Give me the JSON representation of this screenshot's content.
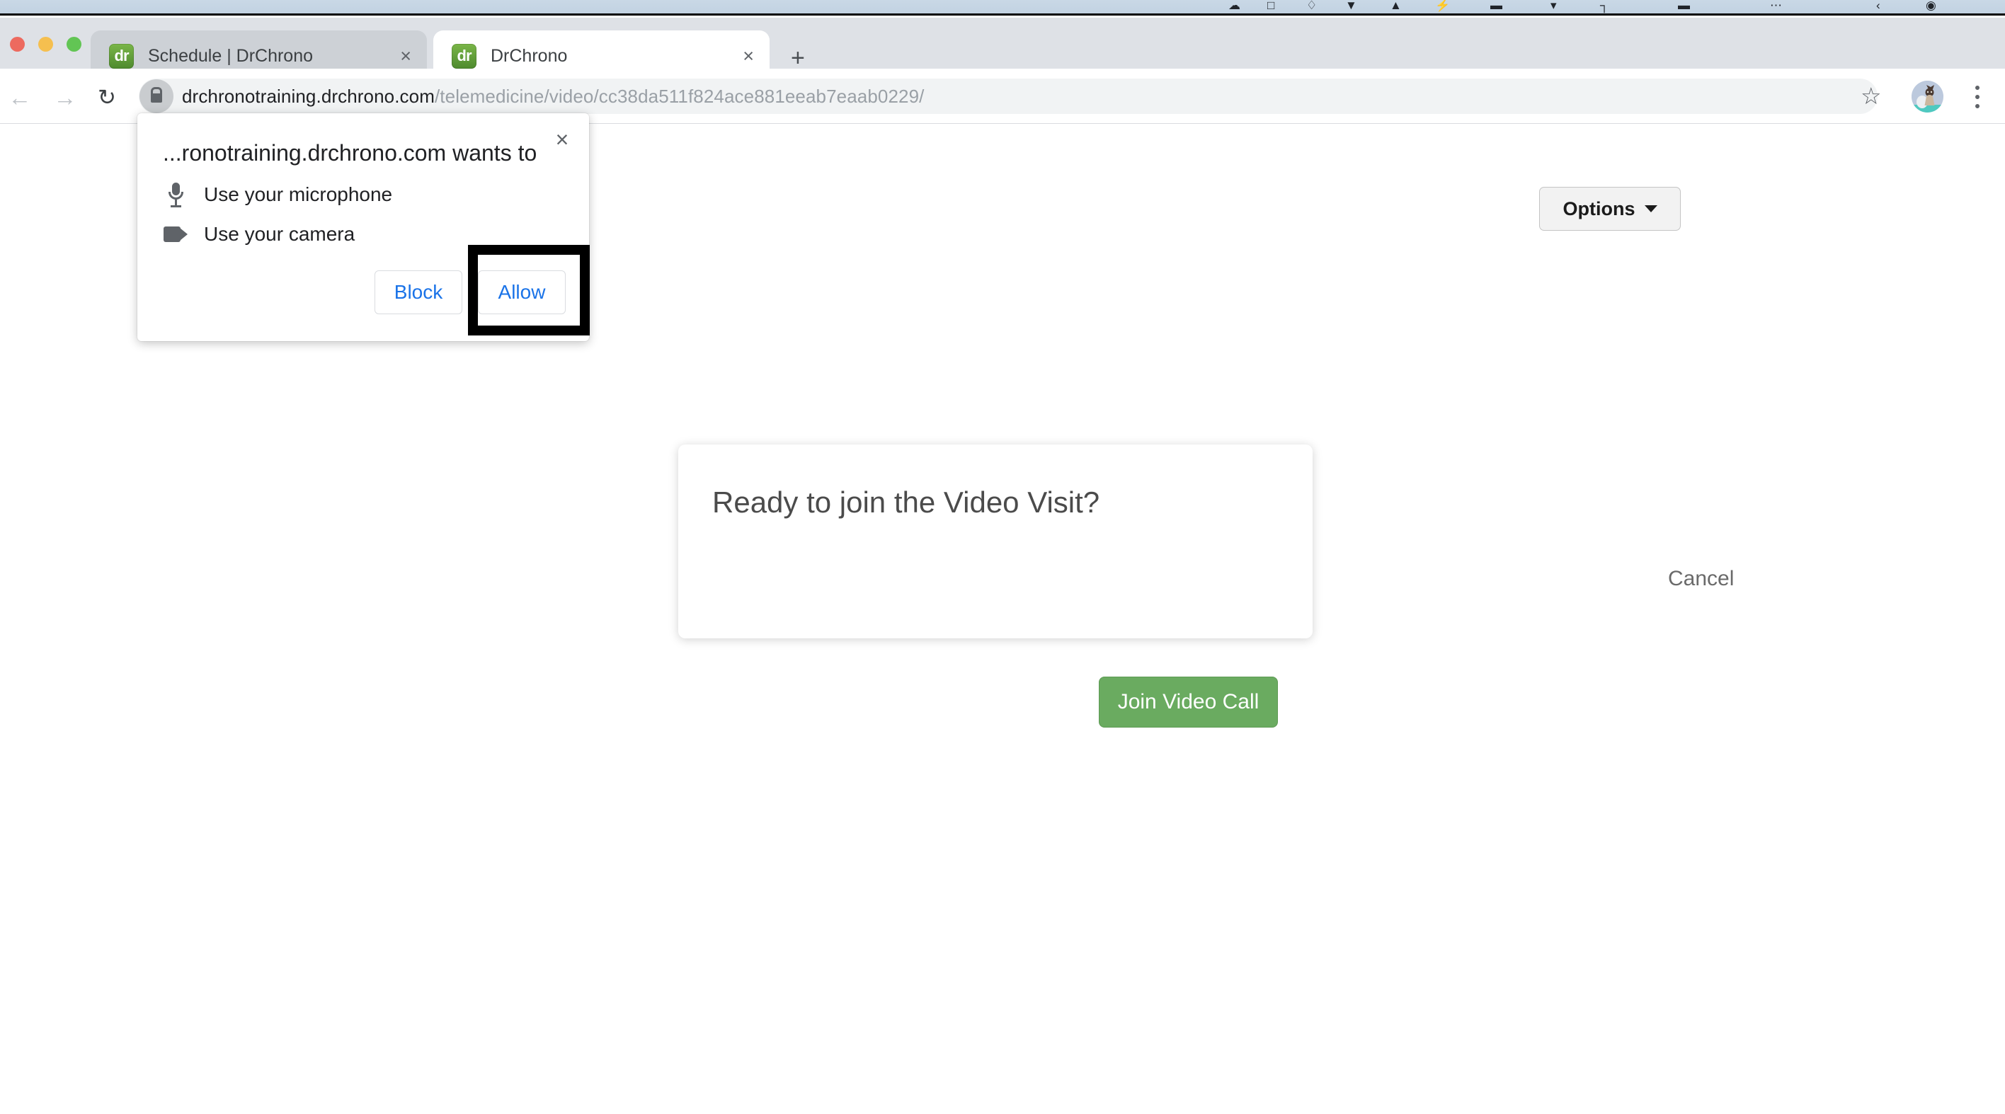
{
  "os_menubar": {
    "glyphs": [
      "☁",
      "□",
      "♢",
      "▼",
      "▲",
      "⚡",
      "▬",
      "▾",
      "┐",
      "▬",
      "⋯",
      "‹",
      "◉"
    ]
  },
  "browser": {
    "tabs": [
      {
        "title": "Schedule | DrChrono",
        "favicon_label": "dr",
        "close_label": "×",
        "active": false
      },
      {
        "title": "DrChrono",
        "favicon_label": "dr",
        "close_label": "×",
        "active": true
      }
    ],
    "new_tab_label": "+",
    "nav": {
      "back_icon": "←",
      "forward_icon": "→",
      "reload_icon": "↻"
    },
    "omnibox": {
      "host": "drchronotraining.drchrono.com",
      "path": "/telemedicine/video/cc38da511f824ace881eeab7eaab0229/",
      "full_url": "drchronotraining.drchrono.com/telemedicine/video/cc38da511f824ace881eeab7eaab0229/",
      "lock_icon": "lock-icon"
    },
    "bookmark_star": "☆",
    "menu_icon": "three-dot-icon",
    "colors": {
      "tab_strip_bg": "#dee1e6",
      "inactive_tab_bg": "#cdd1d6",
      "active_tab_bg": "#ffffff",
      "omnibox_bg": "#f1f3f4",
      "link_blue": "#1a73e8"
    }
  },
  "permission_bubble": {
    "heading": "...ronotraining.drchrono.com wants to",
    "close_label": "×",
    "permissions": [
      {
        "icon": "microphone-icon",
        "label": "Use your microphone"
      },
      {
        "icon": "camera-icon",
        "label": "Use your camera"
      }
    ],
    "block_label": "Block",
    "allow_label": "Allow",
    "highlighted_action": "Allow"
  },
  "page": {
    "options_button": {
      "label": "Options",
      "caret_icon": "chevron-down-icon"
    },
    "modal": {
      "title": "Ready to join the Video Visit?",
      "cancel_label": "Cancel",
      "join_label": "Join Video Call",
      "join_button_color": "#6aab60"
    }
  }
}
